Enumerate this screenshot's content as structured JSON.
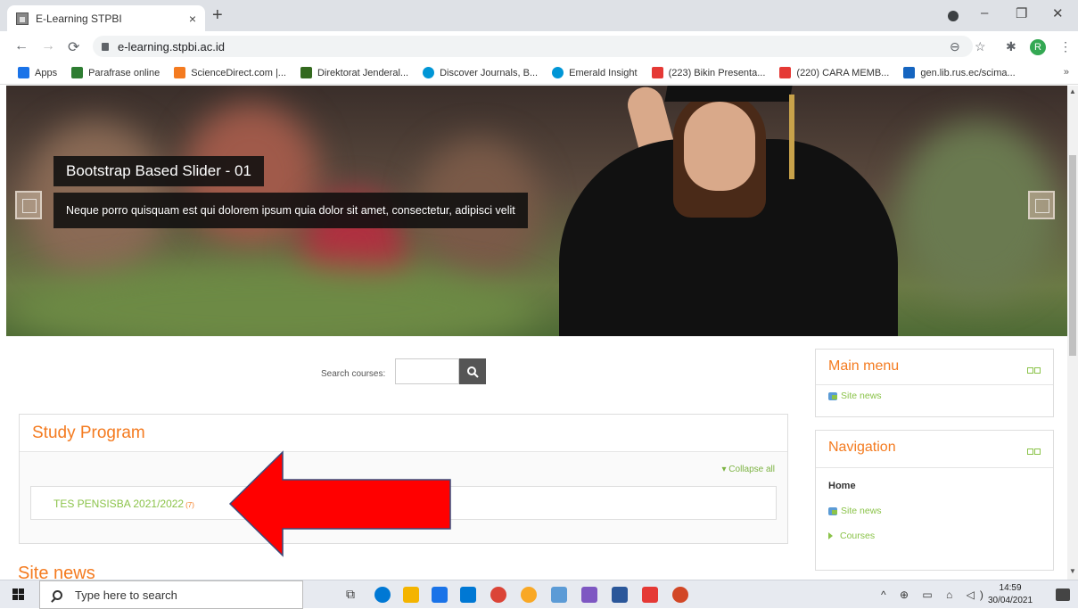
{
  "browser": {
    "tab_title": "E-Learning STPBI",
    "tab_close": "×",
    "new_tab": "+",
    "url": "e-learning.stpbi.ac.id",
    "profile_initial": "R",
    "min": "–",
    "restore": "❐",
    "close": "✕"
  },
  "bookmarks": {
    "items": [
      {
        "label": "Apps",
        "color": "#1a73e8"
      },
      {
        "label": "Parafrase online",
        "color": "#2e7d32"
      },
      {
        "label": "ScienceDirect.com |...",
        "color": "#f47b20"
      },
      {
        "label": "Direktorat Jenderal...",
        "color": "#33691e"
      },
      {
        "label": "Discover Journals, B...",
        "color": "#0096d6"
      },
      {
        "label": "Emerald Insight",
        "color": "#0096d6"
      },
      {
        "label": "(223) Bikin Presenta...",
        "color": "#e53935"
      },
      {
        "label": "(220) CARA MEMB...",
        "color": "#e53935"
      },
      {
        "label": "gen.lib.rus.ec/scima...",
        "color": "#1565c0"
      }
    ],
    "more": "»"
  },
  "slider": {
    "title": "Bootstrap Based Slider - 01",
    "text": "Neque porro quisquam est qui dolorem ipsum quia dolor sit amet, consectetur, adipisci velit"
  },
  "search": {
    "label": "Search courses:"
  },
  "study": {
    "heading": "Study Program",
    "collapse_all": "Collapse all",
    "category_name": "TES PENSISBA 2021/2022",
    "category_count": "(7)"
  },
  "site_news_heading": "Site news",
  "main_menu": {
    "title": "Main menu",
    "items": [
      "Site news"
    ]
  },
  "navigation": {
    "title": "Navigation",
    "home": "Home",
    "site_news": "Site news",
    "courses": "Courses"
  },
  "taskbar": {
    "search_placeholder": "Type here to search",
    "time": "14:59",
    "date": "30/04/2021",
    "tray": "^ ⊕ ▭ ⌂ ◁)"
  },
  "colors": {
    "accent": "#f47b20",
    "link": "#8bc34a",
    "arrow": "#ff0000"
  }
}
